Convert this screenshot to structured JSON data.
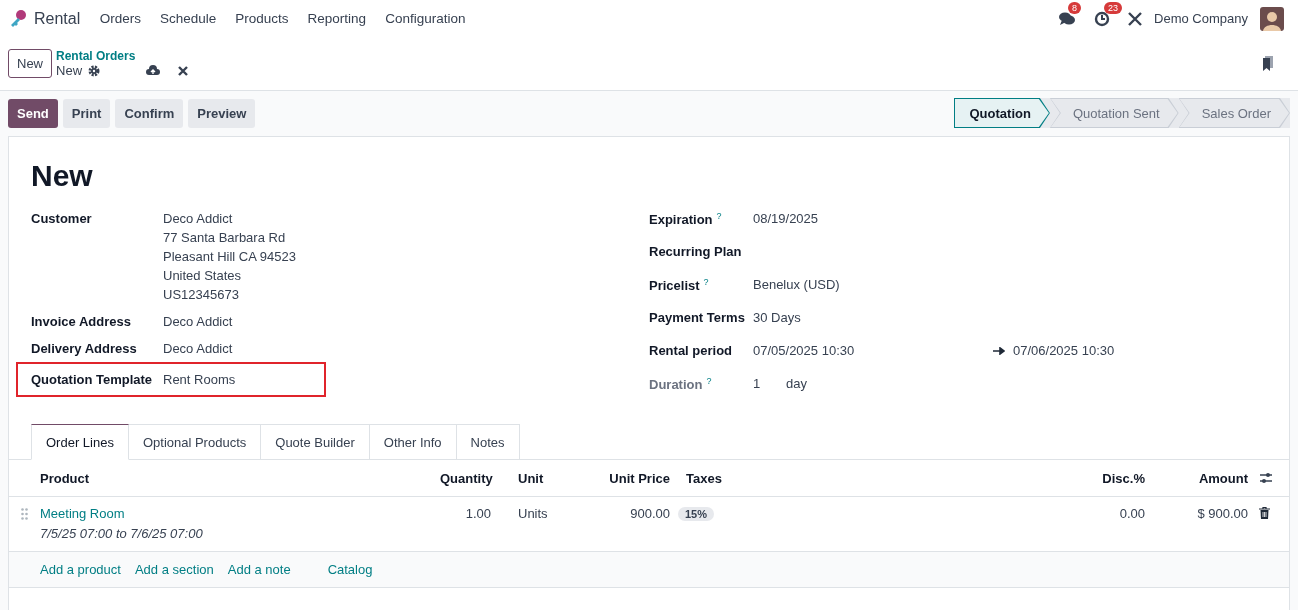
{
  "navbar": {
    "app_name": "Rental",
    "menu": [
      "Orders",
      "Schedule",
      "Products",
      "Reporting",
      "Configuration"
    ],
    "messages_count": "8",
    "activities_count": "23",
    "company": "Demo Company"
  },
  "control_panel": {
    "new_button": "New",
    "breadcrumb": "Rental Orders",
    "record": "New"
  },
  "actions": [
    {
      "label": "Send",
      "kind": "primary"
    },
    {
      "label": "Print",
      "kind": "secondary"
    },
    {
      "label": "Confirm",
      "kind": "secondary"
    },
    {
      "label": "Preview",
      "kind": "secondary"
    }
  ],
  "stages": [
    {
      "label": "Quotation",
      "selected": true
    },
    {
      "label": "Quotation Sent",
      "selected": false
    },
    {
      "label": "Sales Order",
      "selected": false
    }
  ],
  "form": {
    "title": "New",
    "left_fields": [
      {
        "label": "Customer",
        "lines": [
          "Deco Addict",
          "77 Santa Barbara Rd",
          "Pleasant Hill CA 94523",
          "United States",
          "US12345673"
        ],
        "highlighted": false
      },
      {
        "label": "Invoice Address",
        "lines": [
          "Deco Addict"
        ],
        "highlighted": false
      },
      {
        "label": "Delivery Address",
        "lines": [
          "Deco Addict"
        ],
        "highlighted": false
      },
      {
        "label": "Quotation Template",
        "lines": [
          "Rent Rooms"
        ],
        "highlighted": true
      }
    ],
    "right_fields": [
      {
        "label": "Expiration",
        "help": "?",
        "value": "08/19/2025",
        "muted": false
      },
      {
        "label": "Recurring Plan",
        "muted": false
      },
      {
        "label": "Pricelist",
        "help": "?",
        "value": "Benelux (USD)",
        "muted": false
      },
      {
        "label": "Payment Terms",
        "value": "30 Days",
        "muted": false
      },
      {
        "label": "Rental period",
        "value": "07/05/2025 10:30",
        "end_value": "07/06/2025 10:30",
        "muted": false
      },
      {
        "label": "Duration",
        "help": "?",
        "value": "1",
        "unit": "day",
        "muted": true
      }
    ]
  },
  "tabs": [
    {
      "label": "Order Lines",
      "selected": true
    },
    {
      "label": "Optional Products",
      "selected": false
    },
    {
      "label": "Quote Builder",
      "selected": false
    },
    {
      "label": "Other Info",
      "selected": false
    },
    {
      "label": "Notes",
      "selected": false
    }
  ],
  "table": {
    "columns": [
      "Product",
      "Quantity",
      "Unit",
      "Unit Price",
      "Taxes",
      "Disc.%",
      "Amount"
    ],
    "rows": [
      {
        "product": "Meeting Room",
        "period": "7/5/25 07:00 to 7/6/25 07:00",
        "quantity": "1.00",
        "unit": "Units",
        "unit_price": "900.00",
        "taxes": [
          "15%"
        ],
        "discount": "0.00",
        "amount": "$ 900.00"
      }
    ],
    "footer_links": [
      "Add a product",
      "Add a section",
      "Add a note",
      "Catalog"
    ]
  }
}
